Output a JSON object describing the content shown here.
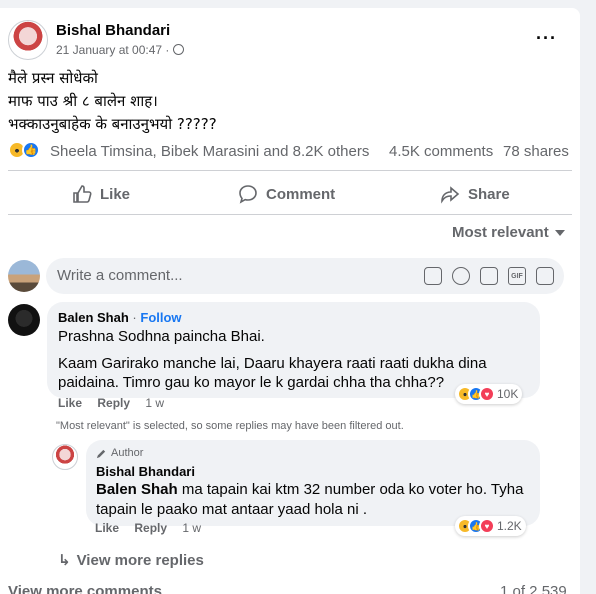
{
  "post": {
    "author": "Bishal Bhandari",
    "timestamp": "21 January at 00:47",
    "audience_separator": "·",
    "more_icon": "···",
    "text_lines": [
      "मैले प्रस्न सोधेको",
      "माफ पाउ श्री ८ बालेन शाह।",
      "भक्काउनुबाहेक के बनाउनुभयो ?????"
    ],
    "reactors": "Sheela Timsina, Bibek Marasini and 8.2K others",
    "comments_count": "4.5K comments",
    "shares_count": "78 shares"
  },
  "actions": {
    "like": "Like",
    "comment": "Comment",
    "share": "Share"
  },
  "sort": {
    "label": "Most relevant"
  },
  "composer": {
    "placeholder": "Write a comment...",
    "gif_label": "GIF"
  },
  "comments": [
    {
      "name": "Balen Shah",
      "separator": "·",
      "follow": "Follow",
      "line1": "Prashna Sodhna paincha Bhai.",
      "line2": "Kaam Garirako manche lai, Daaru khayera raati raati dukha dina",
      "line3": "paidaina. Timro gau ko mayor le k gardai chha tha chha??",
      "reaction_count": "10K",
      "like": "Like",
      "reply": "Reply",
      "time": "1 w"
    }
  ],
  "filter_note": "\"Most relevant\" is selected, so some replies may have been filtered out.",
  "reply": {
    "badge": "Author",
    "name": "Bishal Bhandari",
    "mention": "Balen Shah",
    "line1_rest": " ma tapain kai ktm 32 number oda ko voter ho. Tyha",
    "line2": "tapain le paako mat antaar yaad hola ni .",
    "reaction_count": "1.2K",
    "like": "Like",
    "reply": "Reply",
    "time": "1 w"
  },
  "view_more_replies": "View more replies",
  "view_more_comments": "View more comments",
  "pager": "1 of 2,539"
}
